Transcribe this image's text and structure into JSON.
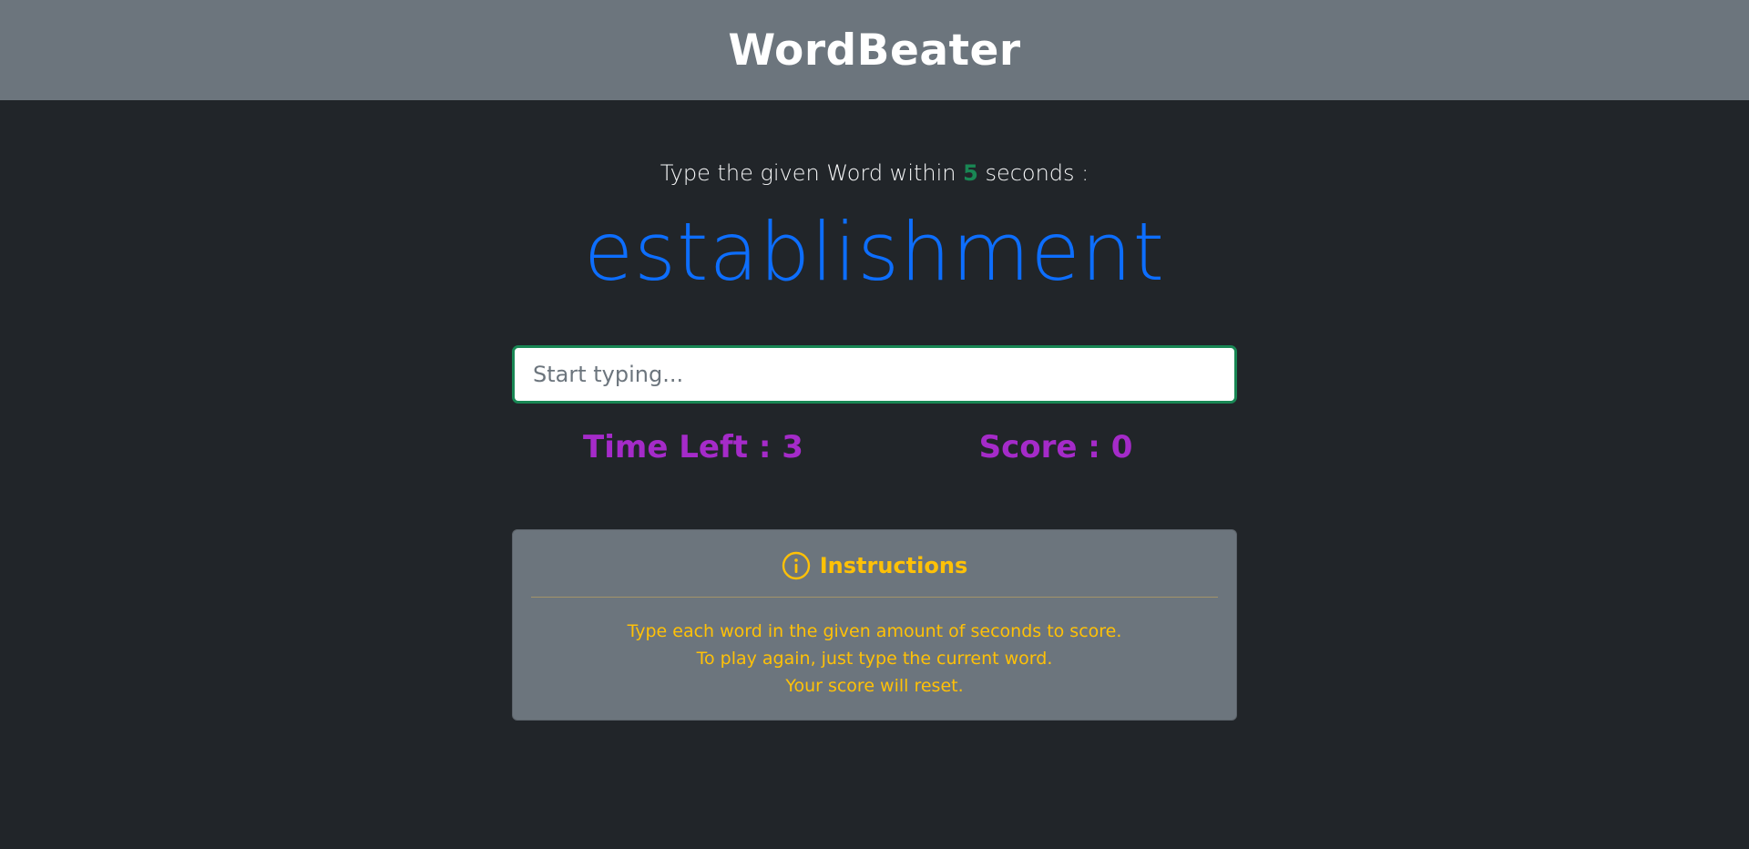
{
  "header": {
    "title": "WordBeater"
  },
  "game": {
    "prompt_before": "Type the given Word within ",
    "seconds": "5",
    "prompt_after": " seconds :",
    "current_word": "establishment",
    "input_placeholder": "Start typing...",
    "input_value": "",
    "time_left_label": "Time Left : ",
    "time_left": "3",
    "score_label": "Score : ",
    "score": "0"
  },
  "instructions": {
    "icon": "info-circle-icon",
    "title": "Instructions",
    "lines": [
      "Type each word in the given amount of seconds to score.",
      "To play again, just type the current word.",
      "Your score will reset."
    ]
  },
  "colors": {
    "header_bg": "#6c757d",
    "page_bg": "#212529",
    "word": "#0d6efd",
    "seconds": "#198754",
    "stats": "#a52bc9",
    "instructions_text": "#ffc107"
  }
}
